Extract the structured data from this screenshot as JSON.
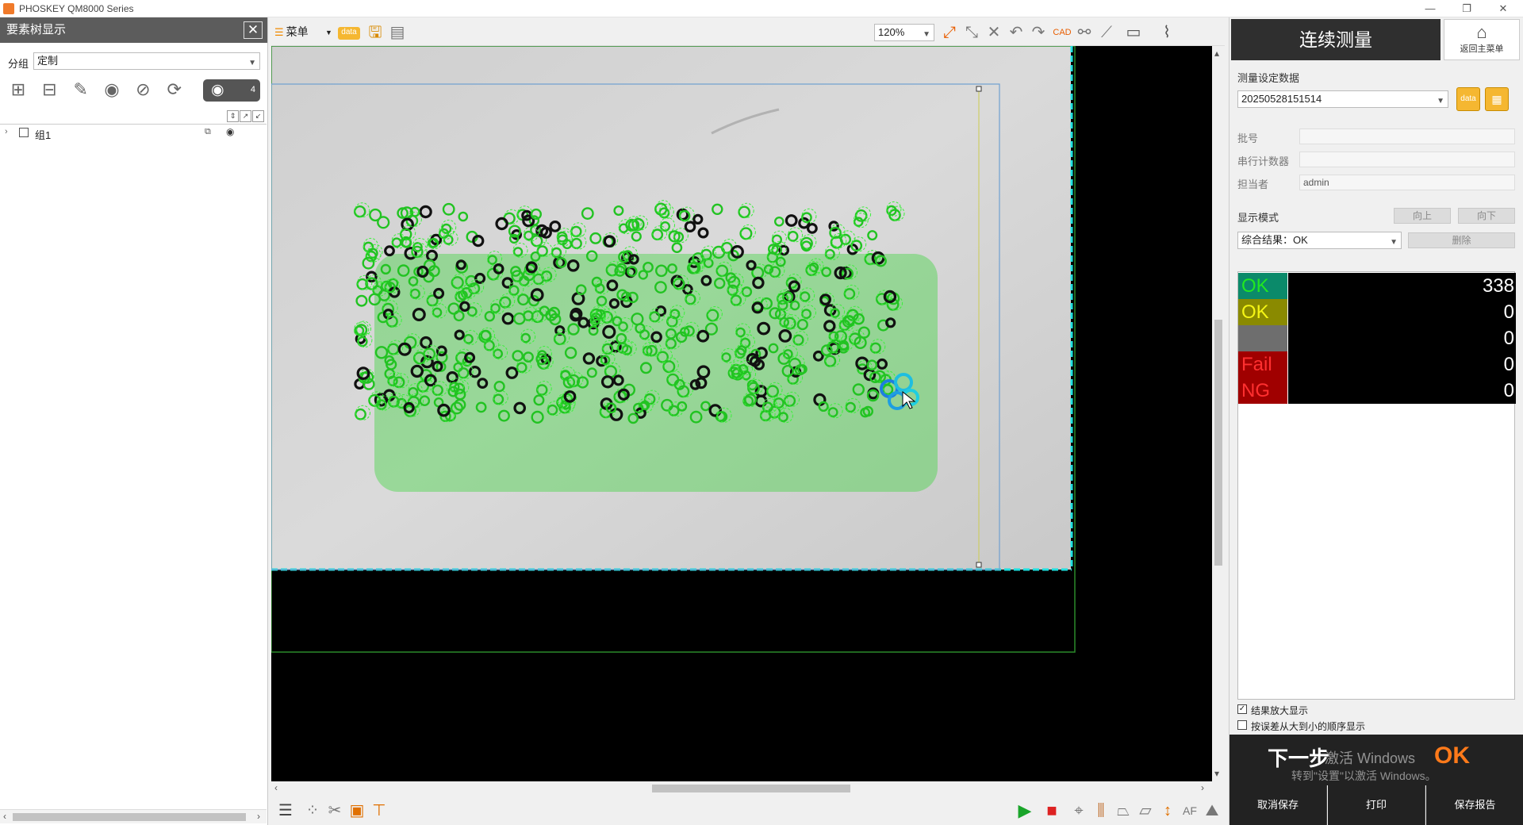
{
  "window": {
    "title": "PHOSKEY QM8000 Series",
    "controls": {
      "minimize": "—",
      "restore": "❐",
      "close": "✕"
    }
  },
  "left_panel": {
    "header": "要素树显示",
    "close_glyph": "✕",
    "group_label": "分组",
    "group_value": "定制",
    "eye_count": "4",
    "tree": [
      {
        "label": "组1"
      }
    ]
  },
  "toolbar": {
    "menu_label": "菜单",
    "data_icon_text": "data",
    "zoom": "120%"
  },
  "right_panel": {
    "mode_title": "连续测量",
    "home_label": "返回主菜单",
    "meas_settings_label": "测量设定数据",
    "meas_settings_value": "20250528151514",
    "folder_data_text": "data",
    "batch_label": "批号",
    "batch_value": "",
    "serial_label": "串行计数器",
    "serial_value": "",
    "operator_label": "担当者",
    "operator_value": "admin",
    "display_mode_label": "显示模式",
    "up_button": "向上",
    "down_button": "向下",
    "result_filter": "综合结果：OK",
    "delete_button": "删除",
    "results": [
      {
        "label": "OK",
        "value": "338",
        "bg": "#0b8a6a",
        "fg": "#21e821"
      },
      {
        "label": "OK",
        "value": "0",
        "bg": "#8a8a00",
        "fg": "#f5f515"
      },
      {
        "label": "",
        "value": "0",
        "bg": "#6e6e6e",
        "fg": "#ffffff"
      },
      {
        "label": "Fail",
        "value": "0",
        "bg": "#a00000",
        "fg": "#ff3030"
      },
      {
        "label": "NG",
        "value": "0",
        "bg": "#a00000",
        "fg": "#ff3030"
      }
    ],
    "check_enlarge": "结果放大显示",
    "check_sort": "按误差从大到小的顺序显示",
    "next_label": "下一步",
    "next_result": "OK",
    "watermark_line1": "激活 Windows",
    "watermark_line2": "转到\"设置\"以激活 Windows。",
    "cancel_save": "取消保存",
    "print": "打印",
    "save_report": "保存报告"
  },
  "colors": {
    "ok_green": "#21e821",
    "canvas_bg": "#000000",
    "cyan_border": "#1ee0e0",
    "accent_orange": "#ff7a1a"
  }
}
